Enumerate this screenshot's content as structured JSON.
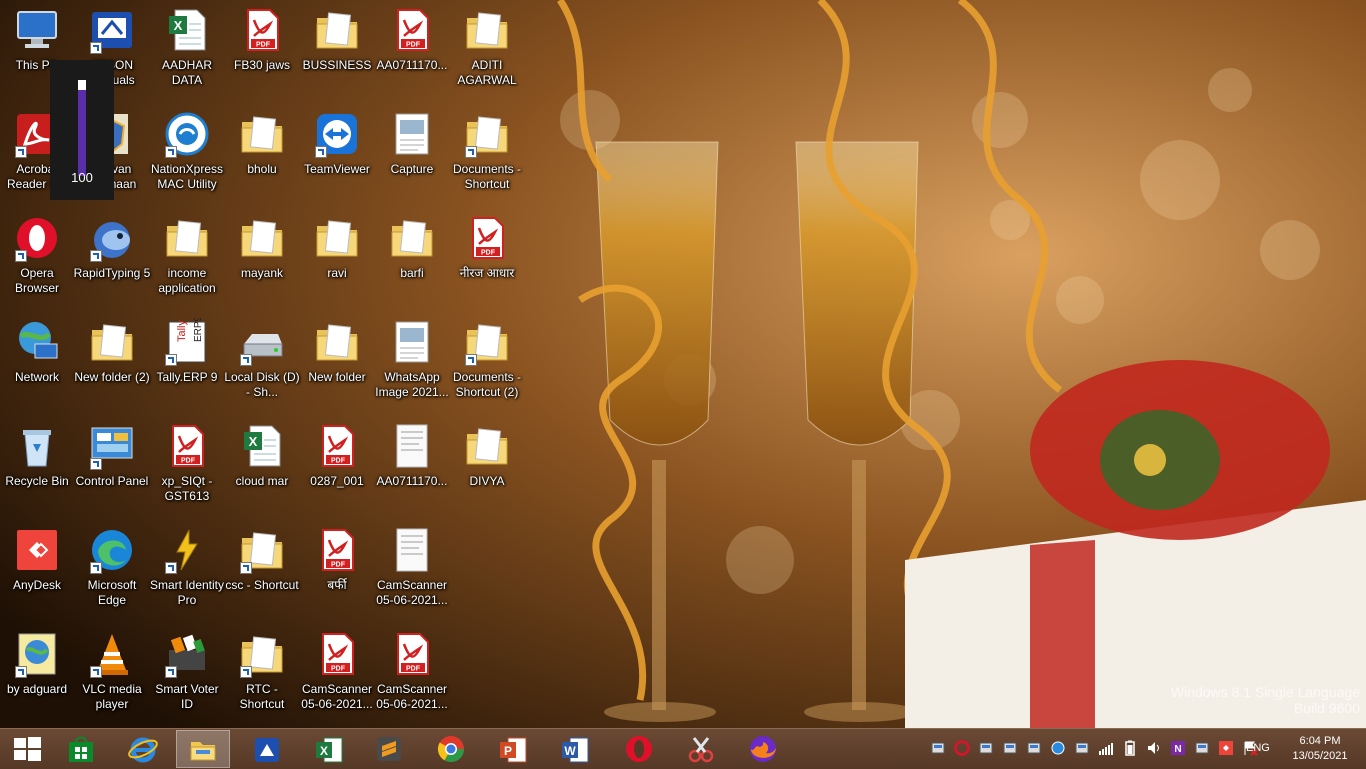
{
  "os": "Windows 8.1",
  "watermark": {
    "line1": "Windows 8.1 Single Language",
    "line2": "Build 9600"
  },
  "volume_osd": {
    "value": "100",
    "level_percent": 100
  },
  "desktop_icons": [
    {
      "label": "This PC",
      "icon": "computer-icon",
      "shortcut": false
    },
    {
      "label": "EPSON Manuals",
      "icon": "epson-manual-icon",
      "shortcut": true
    },
    {
      "label": "AADHAR DATA",
      "icon": "excel-file-icon",
      "shortcut": false
    },
    {
      "label": "FB30 jaws",
      "icon": "pdf-file-icon",
      "shortcut": false
    },
    {
      "label": "BUSSINESS",
      "icon": "folder-icon",
      "shortcut": false
    },
    {
      "label": "AA0711170...",
      "icon": "pdf-file-icon",
      "shortcut": false
    },
    {
      "label": "ADITI AGARWAL",
      "icon": "folder-icon",
      "shortcut": false
    },
    {
      "label": "Acrobat Reader DC",
      "icon": "acrobat-icon",
      "shortcut": true
    },
    {
      "label": "Jeevan Pramaan",
      "icon": "jeevan-pramaan-icon",
      "shortcut": true
    },
    {
      "label": "NationXpress MAC Utility",
      "icon": "nationxpress-icon",
      "shortcut": true
    },
    {
      "label": "bholu",
      "icon": "folder-icon",
      "shortcut": false
    },
    {
      "label": "TeamViewer",
      "icon": "teamviewer-icon",
      "shortcut": true
    },
    {
      "label": "Capture",
      "icon": "image-file-icon",
      "shortcut": false
    },
    {
      "label": "Documents - Shortcut",
      "icon": "folder-icon",
      "shortcut": true
    },
    {
      "label": "Opera Browser",
      "icon": "opera-icon",
      "shortcut": true
    },
    {
      "label": "RapidTyping 5",
      "icon": "rapidtyping-icon",
      "shortcut": true
    },
    {
      "label": "income application",
      "icon": "folder-icon",
      "shortcut": false
    },
    {
      "label": "mayank",
      "icon": "folder-icon",
      "shortcut": false
    },
    {
      "label": "ravi",
      "icon": "folder-icon",
      "shortcut": false
    },
    {
      "label": "barfi",
      "icon": "folder-icon",
      "shortcut": false
    },
    {
      "label": "नीरज आधार",
      "icon": "pdf-file-icon",
      "shortcut": false
    },
    {
      "label": "Network",
      "icon": "network-icon",
      "shortcut": false
    },
    {
      "label": "New folder (2)",
      "icon": "folder-icon",
      "shortcut": false
    },
    {
      "label": "Tally.ERP 9",
      "icon": "tally-icon",
      "shortcut": true
    },
    {
      "label": "Local Disk (D) - Sh...",
      "icon": "drive-icon",
      "shortcut": true
    },
    {
      "label": "New folder",
      "icon": "folder-icon",
      "shortcut": false
    },
    {
      "label": "WhatsApp Image 2021...",
      "icon": "image-file-icon",
      "shortcut": false
    },
    {
      "label": "Documents - Shortcut (2)",
      "icon": "folder-icon",
      "shortcut": true
    },
    {
      "label": "Recycle Bin",
      "icon": "recycle-bin-icon",
      "shortcut": false
    },
    {
      "label": "Control Panel",
      "icon": "control-panel-icon",
      "shortcut": true
    },
    {
      "label": "xp_SIQt - GST613",
      "icon": "pdf-file-icon",
      "shortcut": false
    },
    {
      "label": "cloud mar",
      "icon": "excel-file-icon",
      "shortcut": false
    },
    {
      "label": "0287_001",
      "icon": "pdf-file-icon",
      "shortcut": false
    },
    {
      "label": "AA0711170...",
      "icon": "document-image-icon",
      "shortcut": false
    },
    {
      "label": "DIVYA",
      "icon": "folder-icon",
      "shortcut": false
    },
    {
      "label": "AnyDesk",
      "icon": "anydesk-icon",
      "shortcut": false
    },
    {
      "label": "Microsoft Edge",
      "icon": "edge-icon",
      "shortcut": true
    },
    {
      "label": "Smart Identity Pro",
      "icon": "smart-identity-icon",
      "shortcut": true
    },
    {
      "label": "csc - Shortcut",
      "icon": "folder-icon",
      "shortcut": true
    },
    {
      "label": "बर्फी",
      "icon": "pdf-file-icon",
      "shortcut": false
    },
    {
      "label": "CamScanner 05-06-2021...",
      "icon": "document-image-icon",
      "shortcut": false
    },
    {
      "label": "by adguard",
      "icon": "adguard-icon",
      "shortcut": true
    },
    {
      "label": "VLC media player",
      "icon": "vlc-icon",
      "shortcut": true
    },
    {
      "label": "Smart Voter ID",
      "icon": "smart-voter-icon",
      "shortcut": true
    },
    {
      "label": "RTC - Shortcut",
      "icon": "folder-icon",
      "shortcut": true
    },
    {
      "label": "CamScanner 05-06-2021...",
      "icon": "pdf-file-icon",
      "shortcut": false
    },
    {
      "label": "CamScanner 05-06-2021...",
      "icon": "pdf-file-icon",
      "shortcut": false
    }
  ],
  "taskbar": {
    "buttons": [
      {
        "name": "start-button",
        "icon": "windows-logo-icon",
        "active": false
      },
      {
        "name": "store-button",
        "icon": "store-icon",
        "active": false
      },
      {
        "name": "internet-explorer-button",
        "icon": "ie-icon",
        "active": false
      },
      {
        "name": "file-explorer-button",
        "icon": "file-explorer-icon",
        "active": true
      },
      {
        "name": "epson-scan-button",
        "icon": "scanner-icon",
        "active": false
      },
      {
        "name": "excel-button",
        "icon": "excel-icon",
        "active": false
      },
      {
        "name": "sublime-button",
        "icon": "sublime-icon",
        "active": false
      },
      {
        "name": "chrome-button",
        "icon": "chrome-icon",
        "active": false
      },
      {
        "name": "powerpoint-button",
        "icon": "powerpoint-icon",
        "active": false
      },
      {
        "name": "word-button",
        "icon": "word-icon",
        "active": false
      },
      {
        "name": "opera-button",
        "icon": "opera-icon",
        "active": false
      },
      {
        "name": "snipping-tool-button",
        "icon": "scissors-icon",
        "active": false
      },
      {
        "name": "firefox-button",
        "icon": "firefox-icon",
        "active": false
      }
    ],
    "tray_icons": [
      "tray-app-icon",
      "opera-tray-icon",
      "tray-app-icon",
      "tray-app-icon",
      "tray-app-icon",
      "network-monitor-icon",
      "tray-app-icon",
      "signal-icon",
      "battery-icon",
      "speaker-icon",
      "onenote-icon",
      "tray-app-icon",
      "anydesk-tray-icon",
      "action-center-flag-icon"
    ],
    "language": "ENG",
    "time": "6:04 PM",
    "date": "13/05/2021"
  }
}
